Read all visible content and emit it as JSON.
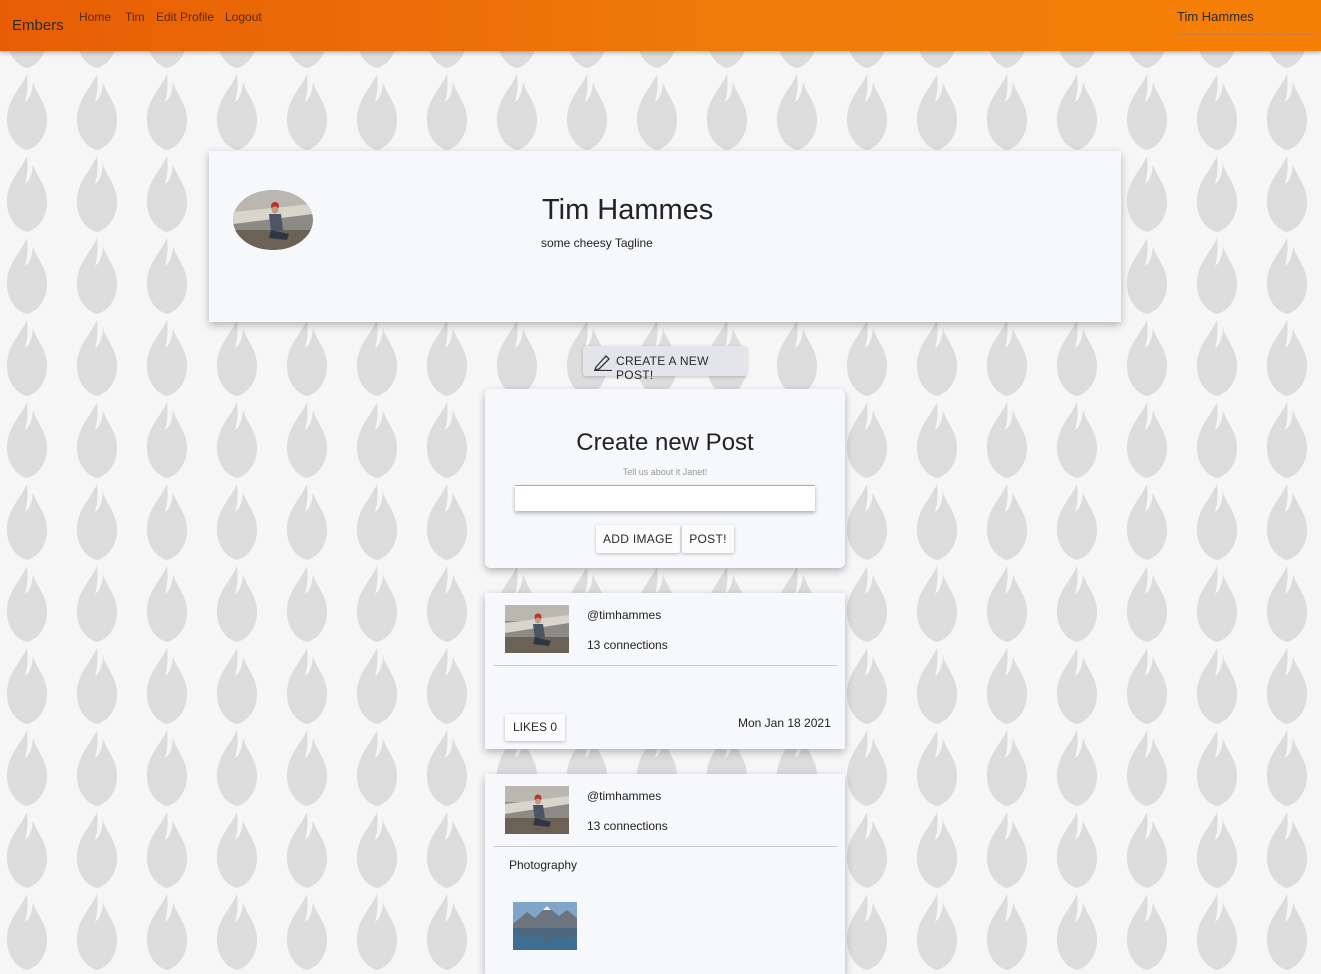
{
  "topbar": {
    "brand": "Embers",
    "nav": [
      "Home",
      "Tim",
      "Edit Profile",
      "Logout"
    ],
    "user_name": "Tim Hammes"
  },
  "profile": {
    "name": "Tim Hammes",
    "tagline": "some cheesy Tagline"
  },
  "create_button": {
    "label": "CREATE A NEW POST!",
    "icon": "pencil-icon"
  },
  "new_post": {
    "title": "Create new Post",
    "hint": "Tell us about it Janet!",
    "input_value": "",
    "add_image_label": "ADD IMAGE",
    "post_label": "POST!"
  },
  "posts": [
    {
      "handle": "@timhammes",
      "connections": "13 connections",
      "body": "",
      "likes_label": "LIKES 0",
      "date": "Mon Jan 18 2021"
    },
    {
      "handle": "@timhammes",
      "connections": "13 connections",
      "body": "Photography"
    }
  ],
  "colors": {
    "topbar_start": "#e85d04",
    "topbar_end": "#f57f05",
    "card_bg": "#f7f8fb",
    "input_accent": "#e7a34c"
  }
}
